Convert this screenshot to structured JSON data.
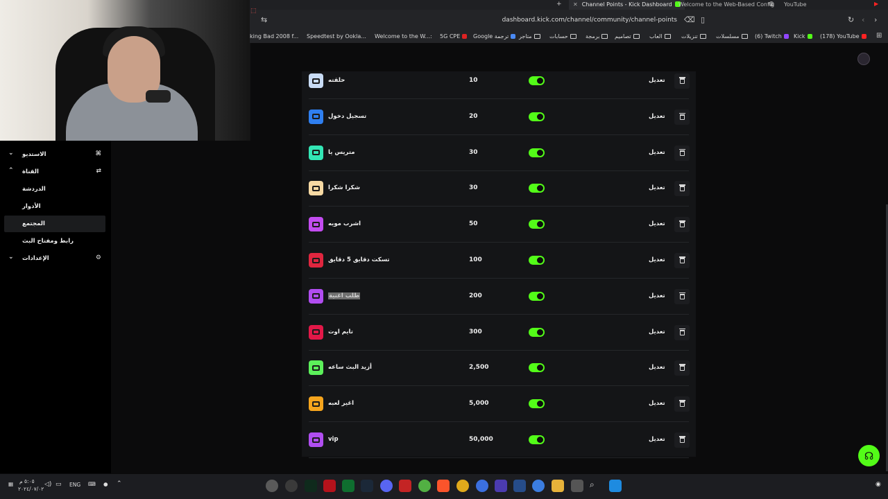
{
  "browser": {
    "tabs": [
      {
        "label": "Channel Points - Kick Dashboard",
        "active": true
      },
      {
        "label": "Welcome to the Web-Based Config",
        "active": false
      },
      {
        "label": "YouTube",
        "active": false
      }
    ],
    "url": "dashboard.kick.com/channel/community/channel-points",
    "bookmarks": [
      "(178) YouTube",
      "Kick",
      "(6) Twitch",
      "مسلسلات",
      "تنزيلات",
      "العاب",
      "تصاميم",
      "برمجة",
      "حسابات",
      "متاجر",
      "Google ترجمة",
      "5G CPE",
      "Welcome to the W...:",
      "Speedtest by Ookla...",
      "king Bad 2008 f..."
    ]
  },
  "sidebar": {
    "items": [
      {
        "label": "الاستديو",
        "expandable": true,
        "icon": "studio-icon"
      },
      {
        "label": "القناة",
        "expandable": true,
        "expanded": true,
        "icon": "channel-icon"
      },
      {
        "label": "الدردشة",
        "sub": true
      },
      {
        "label": "الأدوار",
        "sub": true
      },
      {
        "label": "المجتمع",
        "sub": true,
        "selected": true
      },
      {
        "label": "رابط ومفتاح البث",
        "sub": true
      },
      {
        "label": "الإعدادات",
        "expandable": true,
        "icon": "gear-icon"
      }
    ]
  },
  "rewards": {
    "edit_label": "تعديل",
    "rows": [
      {
        "title": "حلقته",
        "cost": "10",
        "color": "#c9dcf5",
        "enabled": true
      },
      {
        "title": "تسجيل دخول",
        "cost": "20",
        "color": "#2f7ff0",
        "enabled": true
      },
      {
        "title": "متريس يا",
        "cost": "30",
        "color": "#33e6b5",
        "enabled": true
      },
      {
        "title": "شكرا شكرا",
        "cost": "30",
        "color": "#f6d9a3",
        "enabled": true
      },
      {
        "title": "اشرب مويه",
        "cost": "50",
        "color": "#c34cf0",
        "enabled": true
      },
      {
        "title": "تسكت دقايق 5 دقايق",
        "cost": "100",
        "color": "#e0263f",
        "enabled": true
      },
      {
        "title": "طلب اغنية",
        "cost": "200",
        "color": "#b14df0",
        "enabled": true,
        "highlighted": true
      },
      {
        "title": "تايم اوت",
        "cost": "300",
        "color": "#e21848",
        "enabled": true
      },
      {
        "title": "أزيد البث ساعه",
        "cost": "2,500",
        "color": "#5cf05a",
        "enabled": true
      },
      {
        "title": "اغير لعبه",
        "cost": "5,000",
        "color": "#f6a51d",
        "enabled": true
      },
      {
        "title": "vip",
        "cost": "50,000",
        "color": "#b04ef0",
        "enabled": true
      }
    ]
  },
  "taskbar": {
    "time": "٥:٠٥ م",
    "date": "٢٠٢٤/٠٧/٠٢",
    "lang": "ENG"
  },
  "colors": {
    "accent": "#53fc18",
    "panel": "#141517",
    "background": "#0b0b0c"
  }
}
